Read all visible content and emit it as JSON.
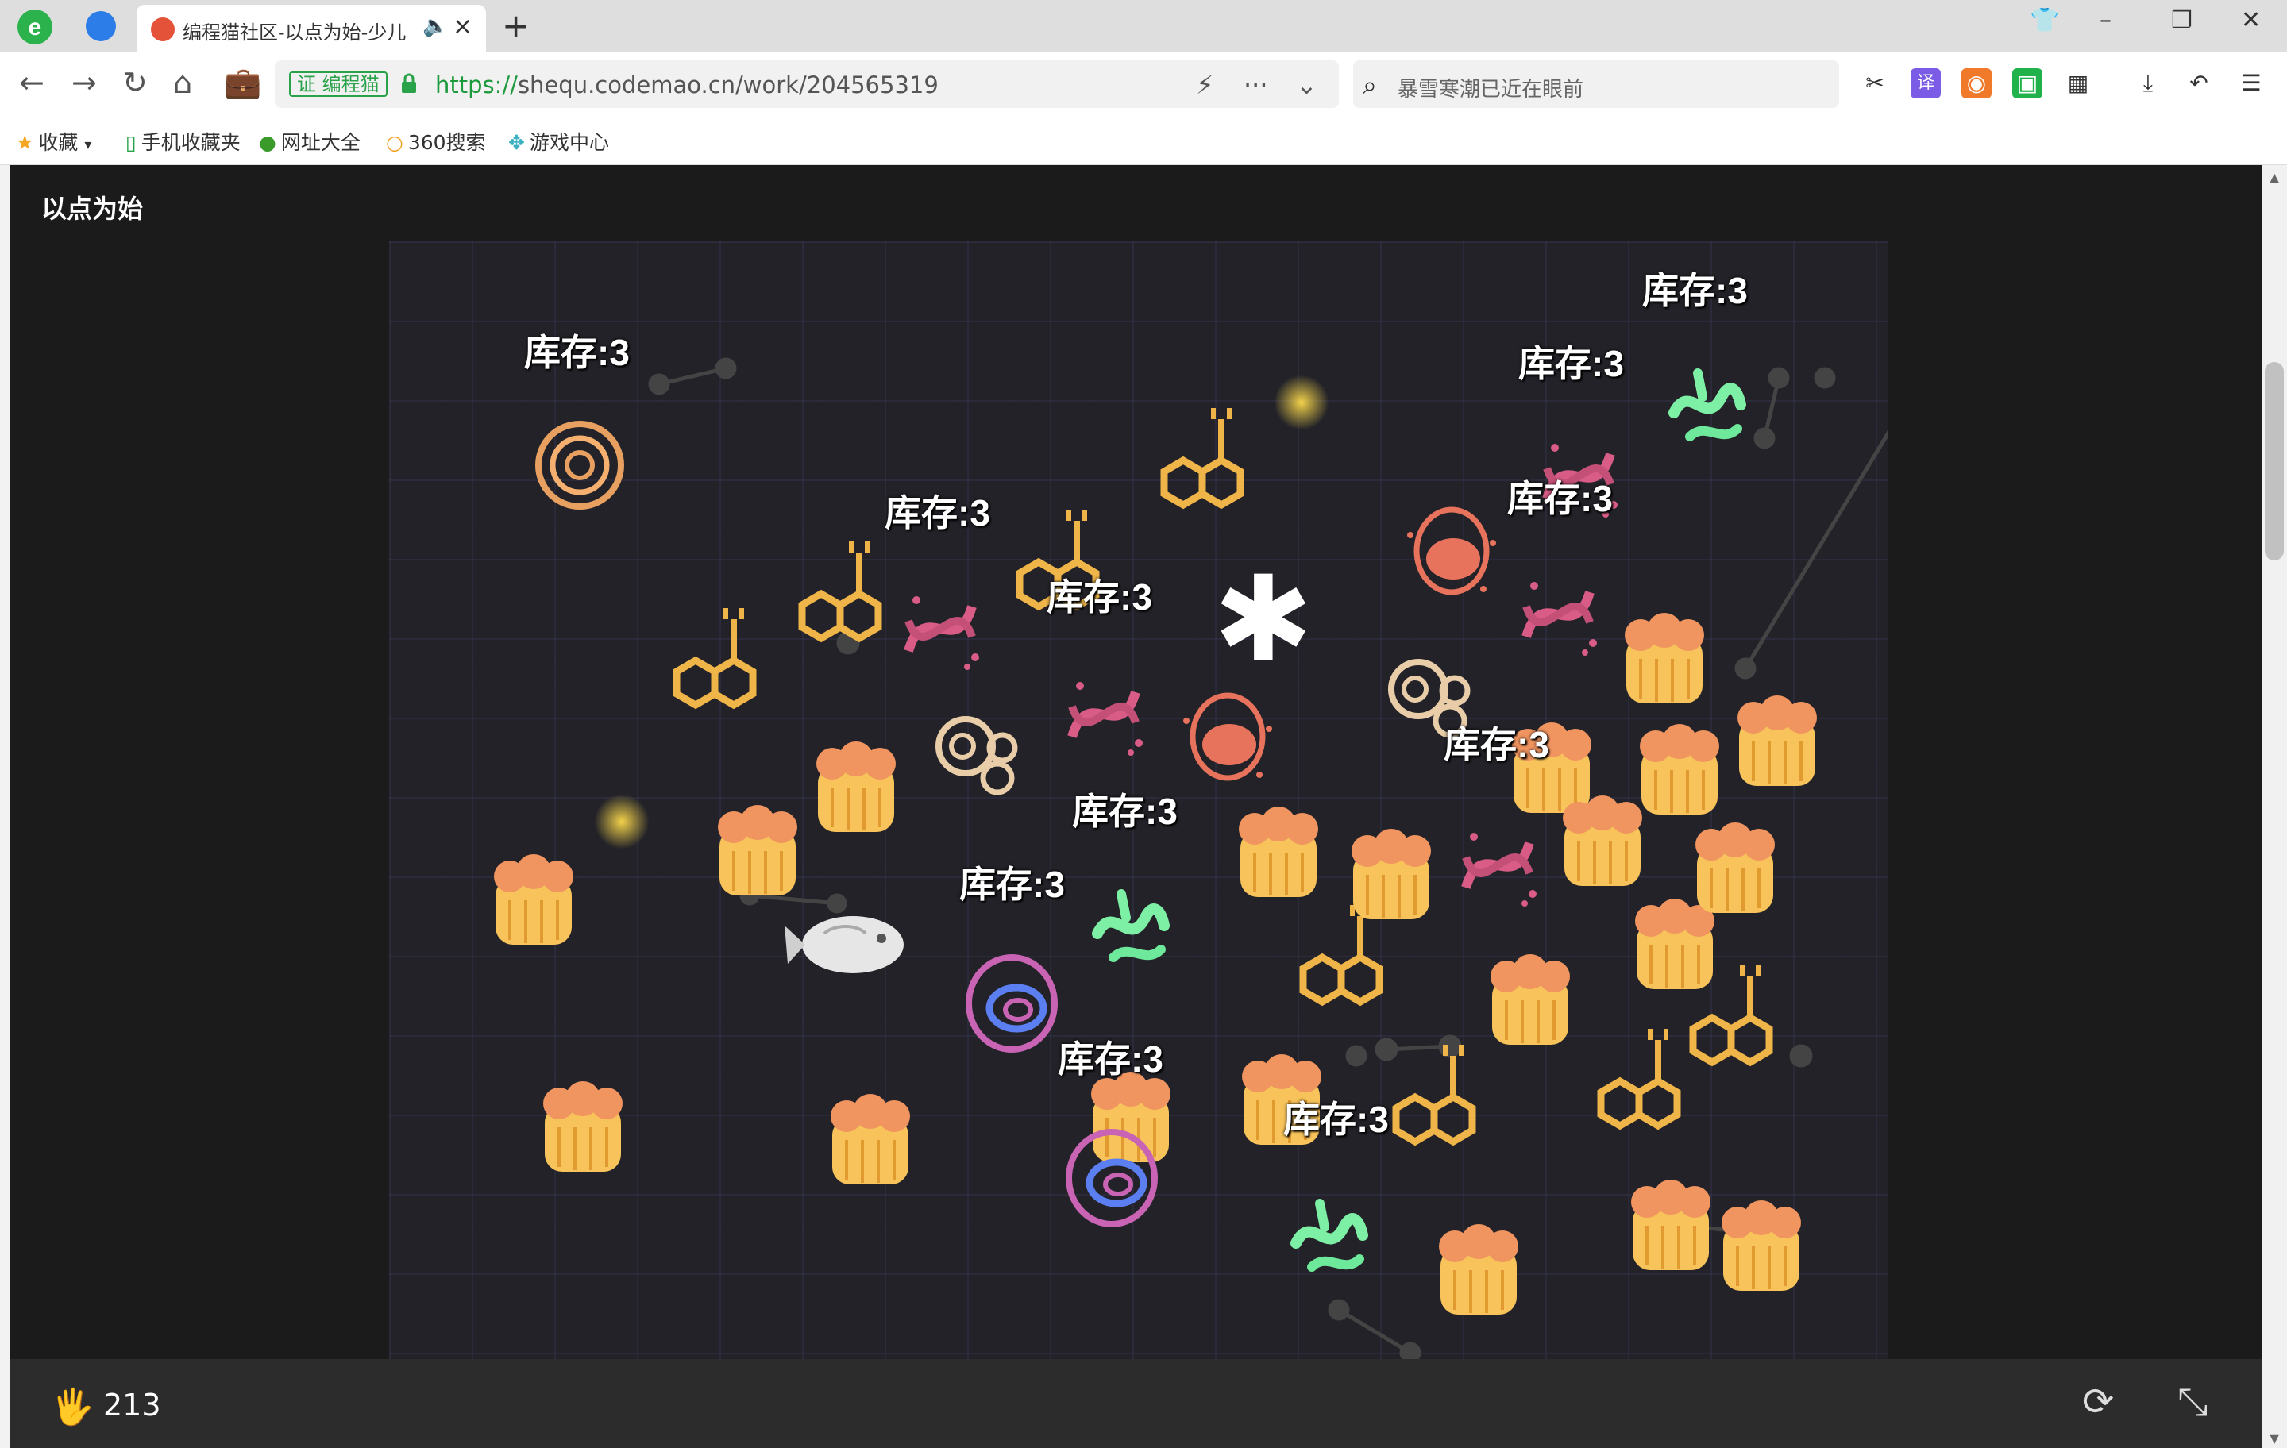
{
  "tab": {
    "title": "编程猫社区-以点为始-少儿"
  },
  "address": {
    "cert_label": "证 编程猫",
    "protocol": "https://",
    "rest": "shequ.codemao.cn/work/204565319"
  },
  "search": {
    "placeholder": "暴雪寒潮已近在眼前"
  },
  "bookmarks": [
    {
      "label": "收藏",
      "icon": "star-icon"
    },
    {
      "label": "手机收藏夹",
      "icon": "phone-icon"
    },
    {
      "label": "网址大全",
      "icon": "globe-icon"
    },
    {
      "label": "360搜索",
      "icon": "search-360-icon"
    },
    {
      "label": "游戏中心",
      "icon": "game-icon"
    }
  ],
  "work": {
    "title": "以点为始"
  },
  "game": {
    "stock_label": "库存:3"
  },
  "footer": {
    "count": "213"
  },
  "colors": {
    "accent_green": "#2aa24a",
    "stage_bg": "#222228",
    "nucleus": "#e8735c",
    "dna": "#d85c86",
    "bacteria": "#7ef0a6",
    "cell_cluster": "#f5b84c",
    "hexagon": "#f0b548"
  }
}
